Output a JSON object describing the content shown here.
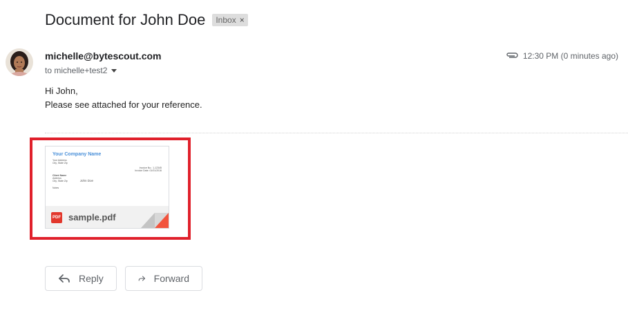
{
  "email": {
    "subject": "Document for John Doe",
    "label": "Inbox",
    "label_close": "×",
    "sender": "michelle@bytescout.com",
    "recipients": "to michelle+test2",
    "timestamp": "12:30 PM (0 minutes ago)",
    "body_lines": [
      "Hi John,",
      "Please see attached for your reference."
    ]
  },
  "attachment": {
    "filename": "sample.pdf",
    "type_badge": "PDF",
    "preview": {
      "company_name": "Your Company Name",
      "address_line1": "Your Address",
      "address_line2": "City, State Zip",
      "invoice_no": "Invoice No.: 1-12345",
      "invoice_date": "Invoice Date: 01/01/2016",
      "client_heading": "Client Name",
      "client_addr1": "Address",
      "client_addr2": "City, State Zip",
      "client_name": "John Doe",
      "notes": "Notes"
    }
  },
  "actions": {
    "reply_label": "Reply",
    "forward_label": "Forward"
  },
  "colors": {
    "highlight": "#e0202b",
    "pdf_badge": "#e2372c",
    "company_name": "#4a90d9"
  }
}
